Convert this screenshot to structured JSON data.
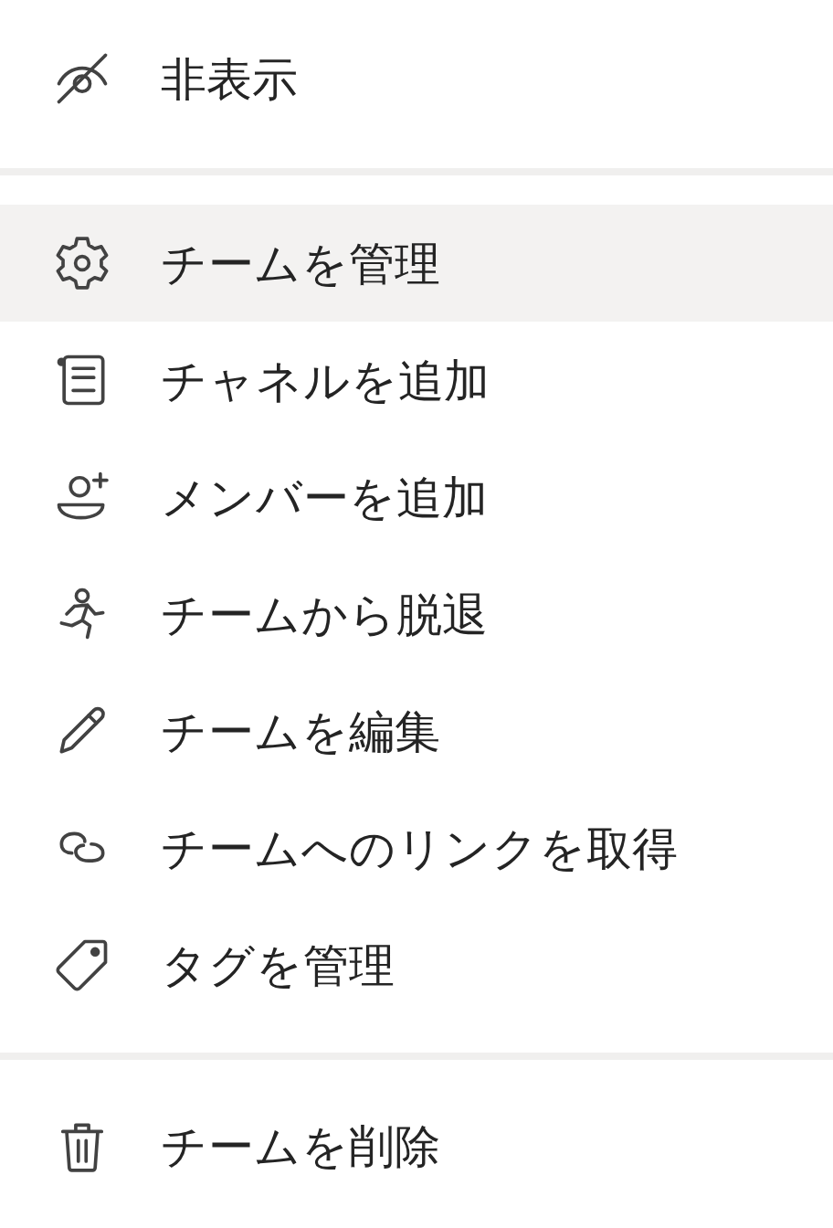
{
  "menu": {
    "sections": [
      {
        "items": [
          {
            "label": "非表示",
            "selected": false
          }
        ]
      },
      {
        "items": [
          {
            "label": "チームを管理",
            "selected": true
          },
          {
            "label": "チャネルを追加",
            "selected": false
          },
          {
            "label": "メンバーを追加",
            "selected": false
          },
          {
            "label": "チームから脱退",
            "selected": false
          },
          {
            "label": "チームを編集",
            "selected": false
          },
          {
            "label": "チームへのリンクを取得",
            "selected": false
          },
          {
            "label": "タグを管理",
            "selected": false
          }
        ]
      },
      {
        "items": [
          {
            "label": "チームを削除",
            "selected": false
          }
        ]
      }
    ]
  }
}
